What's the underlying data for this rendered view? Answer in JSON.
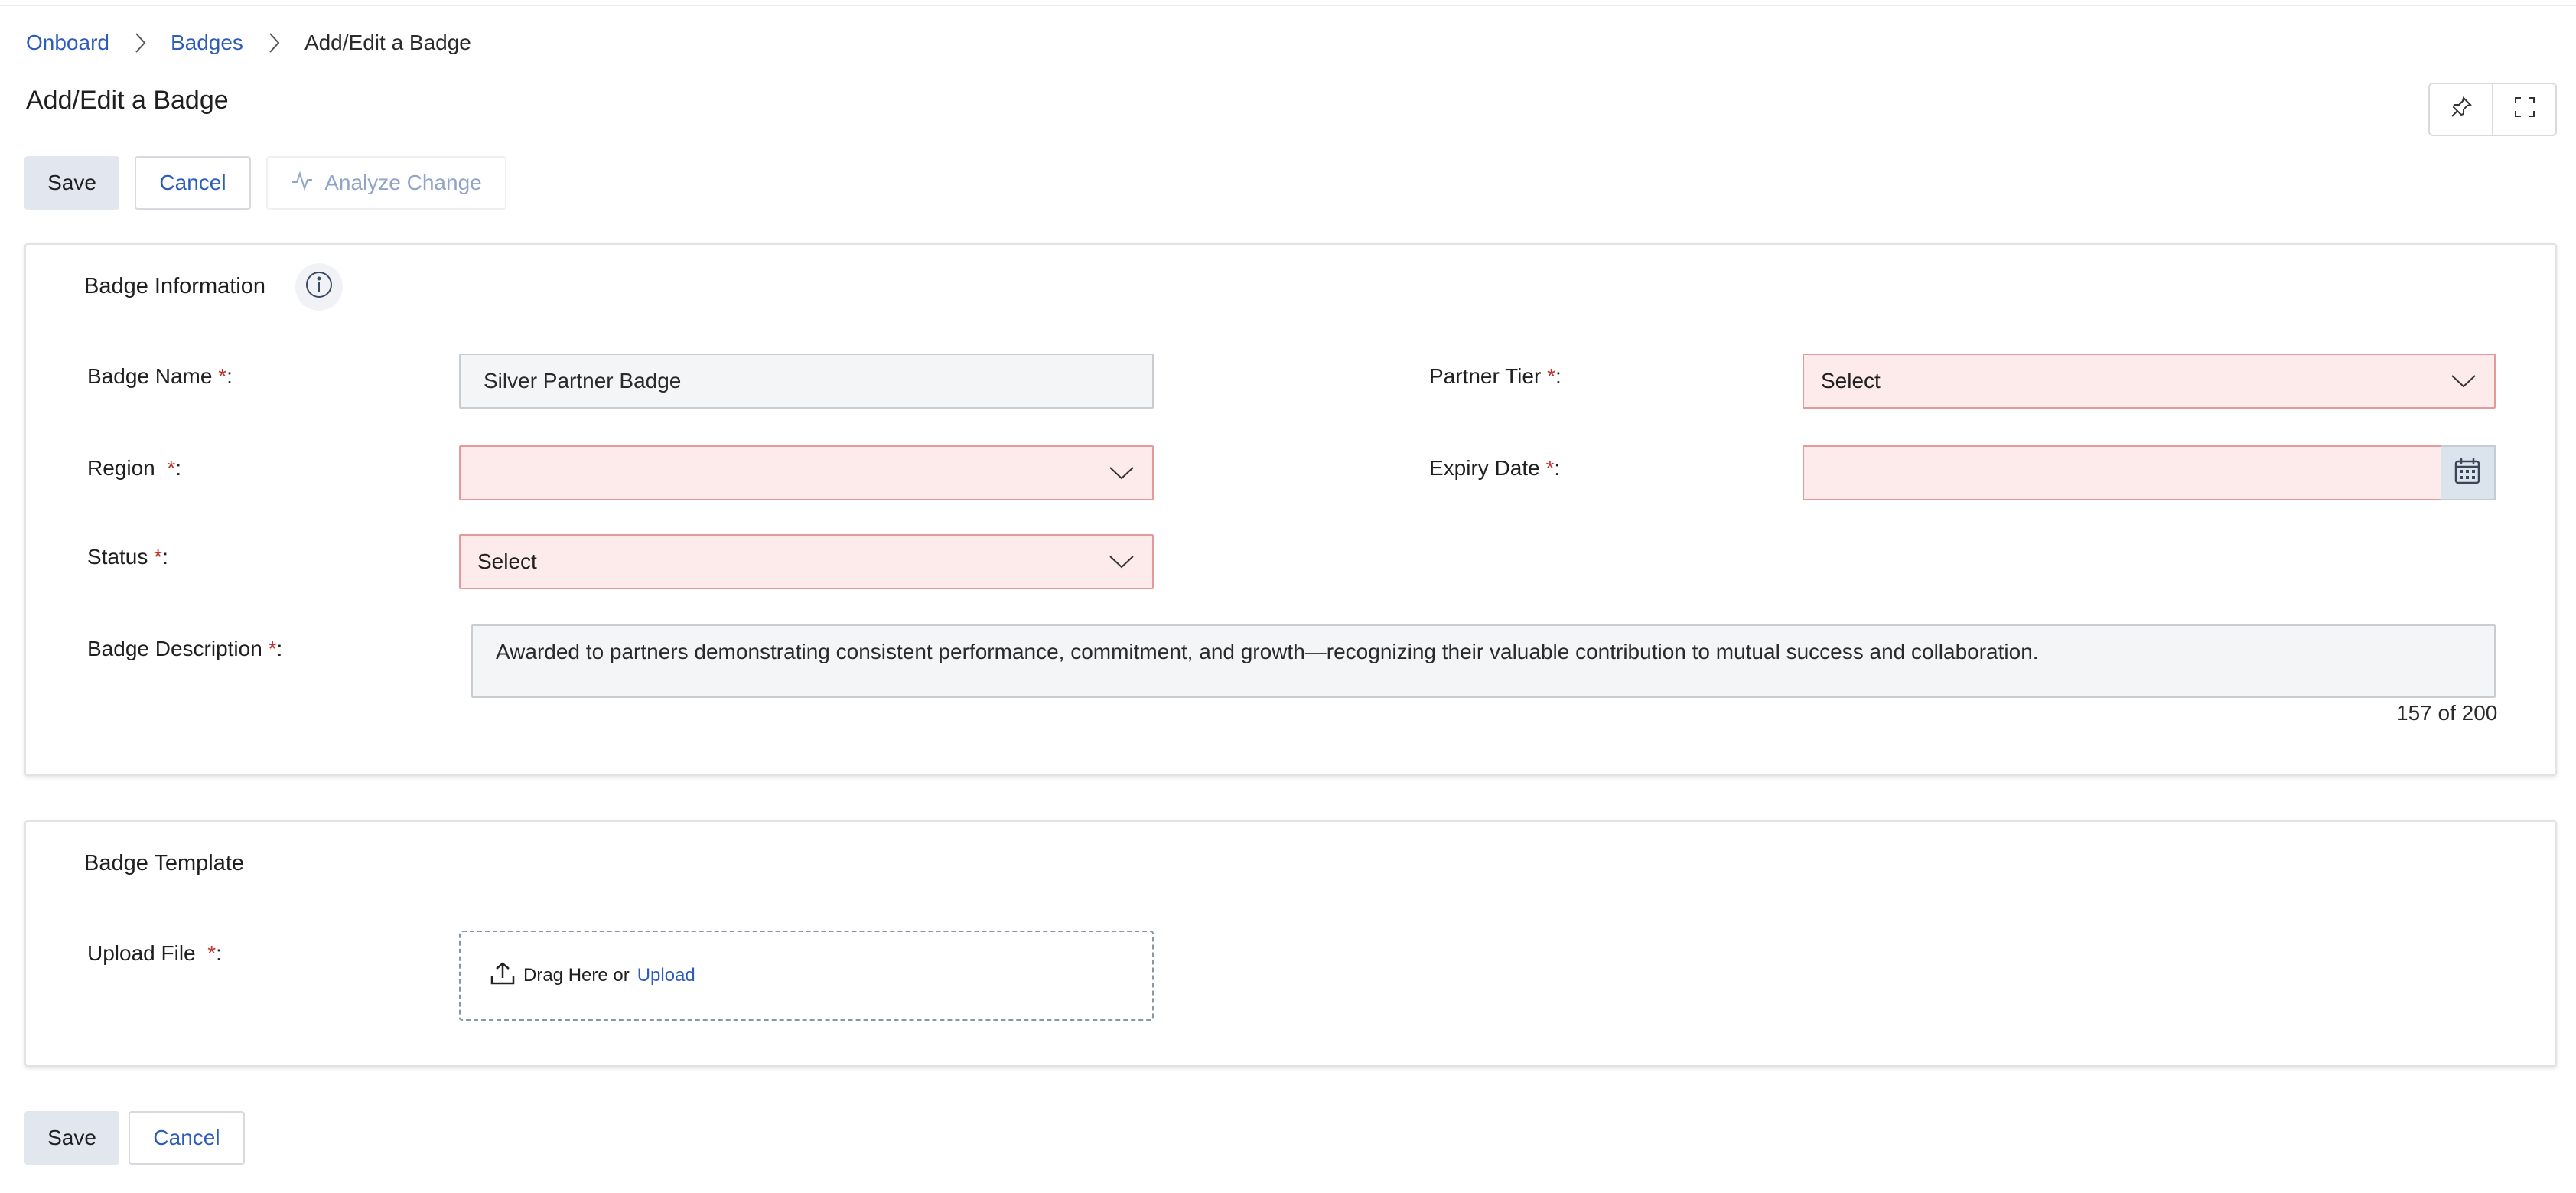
{
  "breadcrumb": {
    "items": [
      "Onboard",
      "Badges"
    ],
    "current": "Add/Edit a Badge"
  },
  "page": {
    "title": "Add/Edit a Badge"
  },
  "toolbar": {
    "save_label": "Save",
    "cancel_label": "Cancel",
    "analyze_label": "Analyze Change"
  },
  "badge_info": {
    "title": "Badge Information",
    "badge_name": {
      "label": "Badge Name",
      "value": "Silver Partner Badge"
    },
    "partner_tier": {
      "label": "Partner Tier",
      "value": "Select"
    },
    "region": {
      "label": "Region",
      "value": ""
    },
    "expiry_date": {
      "label": "Expiry Date",
      "value": ""
    },
    "status": {
      "label": "Status",
      "value": "Select"
    },
    "description": {
      "label": "Badge Description",
      "value": "Awarded to partners demonstrating consistent performance, commitment, and growth—recognizing their valuable contribution to mutual success and collaboration.",
      "char_count": "157 of 200"
    }
  },
  "badge_template": {
    "title": "Badge Template",
    "upload_file": {
      "label": "Upload File",
      "drag_text": "Drag Here or",
      "upload_link": "Upload"
    }
  },
  "footer": {
    "save_label": "Save",
    "cancel_label": "Cancel"
  },
  "required_marker": "*",
  "colors": {
    "link": "#2d5db8",
    "required": "#c0342b",
    "error_bg": "#fdeaea",
    "error_border": "#e49a9a",
    "save_bg": "#e2e6ee"
  },
  "icons": [
    "chevron-right-icon",
    "pin-icon",
    "fullscreen-icon",
    "activity-icon",
    "info-icon",
    "chevron-down-icon",
    "calendar-icon",
    "upload-icon"
  ]
}
